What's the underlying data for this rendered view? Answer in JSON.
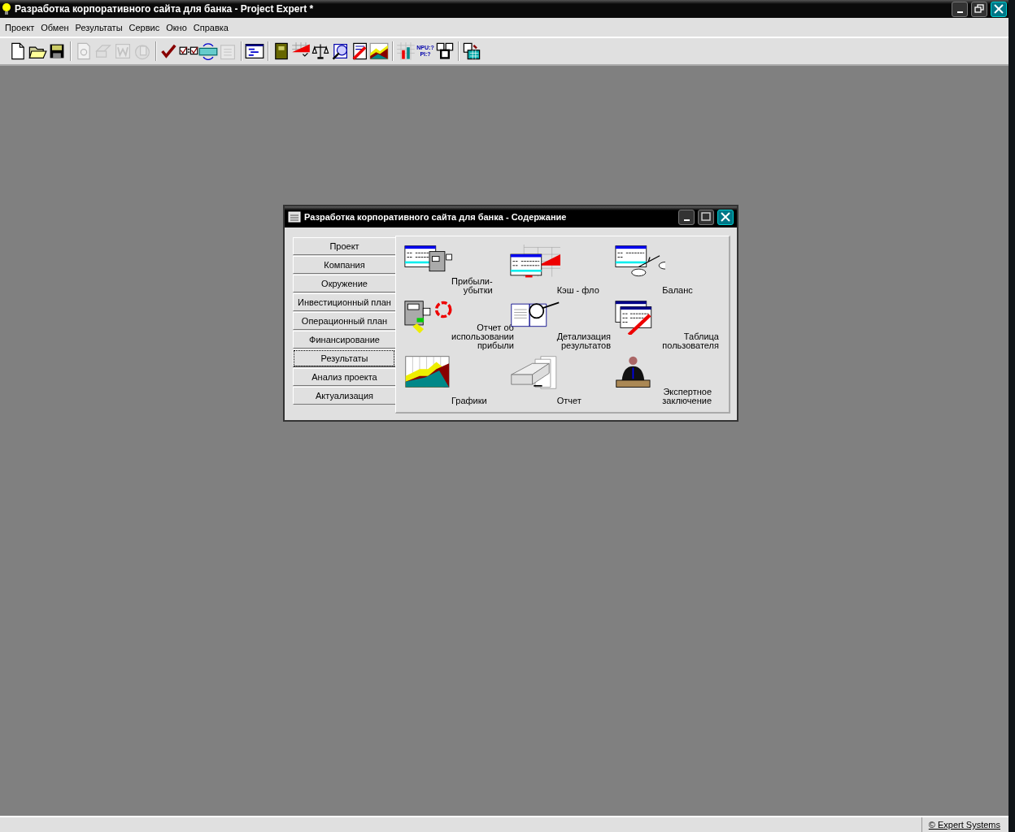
{
  "window": {
    "title": "Разработка корпоративного сайта для банка - Project Expert *"
  },
  "menu": [
    "Проект",
    "Обмен",
    "Результаты",
    "Сервис",
    "Окно",
    "Справка"
  ],
  "toolbar": [
    [
      {
        "disabled": false
      },
      {
        "disabled": false
      },
      {
        "disabled": false
      }
    ],
    [
      {
        "disabled": true
      },
      {
        "disabled": true
      },
      {
        "disabled": true
      },
      {
        "disabled": true
      }
    ],
    [
      {
        "disabled": false
      },
      {
        "disabled": false
      },
      {
        "disabled": false
      },
      {
        "disabled": true
      }
    ],
    [
      {
        "disabled": false
      }
    ],
    [
      {
        "disabled": false
      },
      {
        "disabled": false
      },
      {
        "disabled": false
      },
      {
        "disabled": false
      },
      {
        "disabled": false
      },
      {
        "disabled": false
      }
    ],
    [
      {
        "disabled": false
      },
      {
        "disabled": false,
        "text": [
          "NPU:?",
          "PI:?"
        ]
      },
      {
        "disabled": false
      }
    ],
    [
      {
        "disabled": false
      }
    ]
  ],
  "dialog": {
    "title": "Разработка корпоративного сайта для банка - Содержание",
    "tabs": [
      {
        "label": "Проект",
        "selected": false
      },
      {
        "label": "Компания",
        "selected": false
      },
      {
        "label": "Окружение",
        "selected": false
      },
      {
        "label": "Инвестиционный план",
        "selected": false
      },
      {
        "label": "Операционный план",
        "selected": false
      },
      {
        "label": "Финансирование",
        "selected": false
      },
      {
        "label": "Результаты",
        "selected": true
      },
      {
        "label": "Анализ проекта",
        "selected": false
      },
      {
        "label": "Актуализация",
        "selected": false
      }
    ],
    "items": [
      {
        "label": [
          "Прибыли-",
          "убытки"
        ]
      },
      {
        "label": [
          "Кэш - фло"
        ]
      },
      {
        "label": [
          "Баланс"
        ]
      },
      {
        "label": [
          "Отчет об",
          "использовании",
          "прибыли"
        ]
      },
      {
        "label": [
          "Детализация",
          "результатов"
        ]
      },
      {
        "label": [
          "Таблица",
          "пользователя"
        ]
      },
      {
        "label": [
          "Графики"
        ]
      },
      {
        "label": [
          "Отчет"
        ]
      },
      {
        "label": [
          "Экспертное",
          "заключение"
        ]
      }
    ]
  },
  "status_bar": {
    "copyright": "© Expert Systems"
  }
}
